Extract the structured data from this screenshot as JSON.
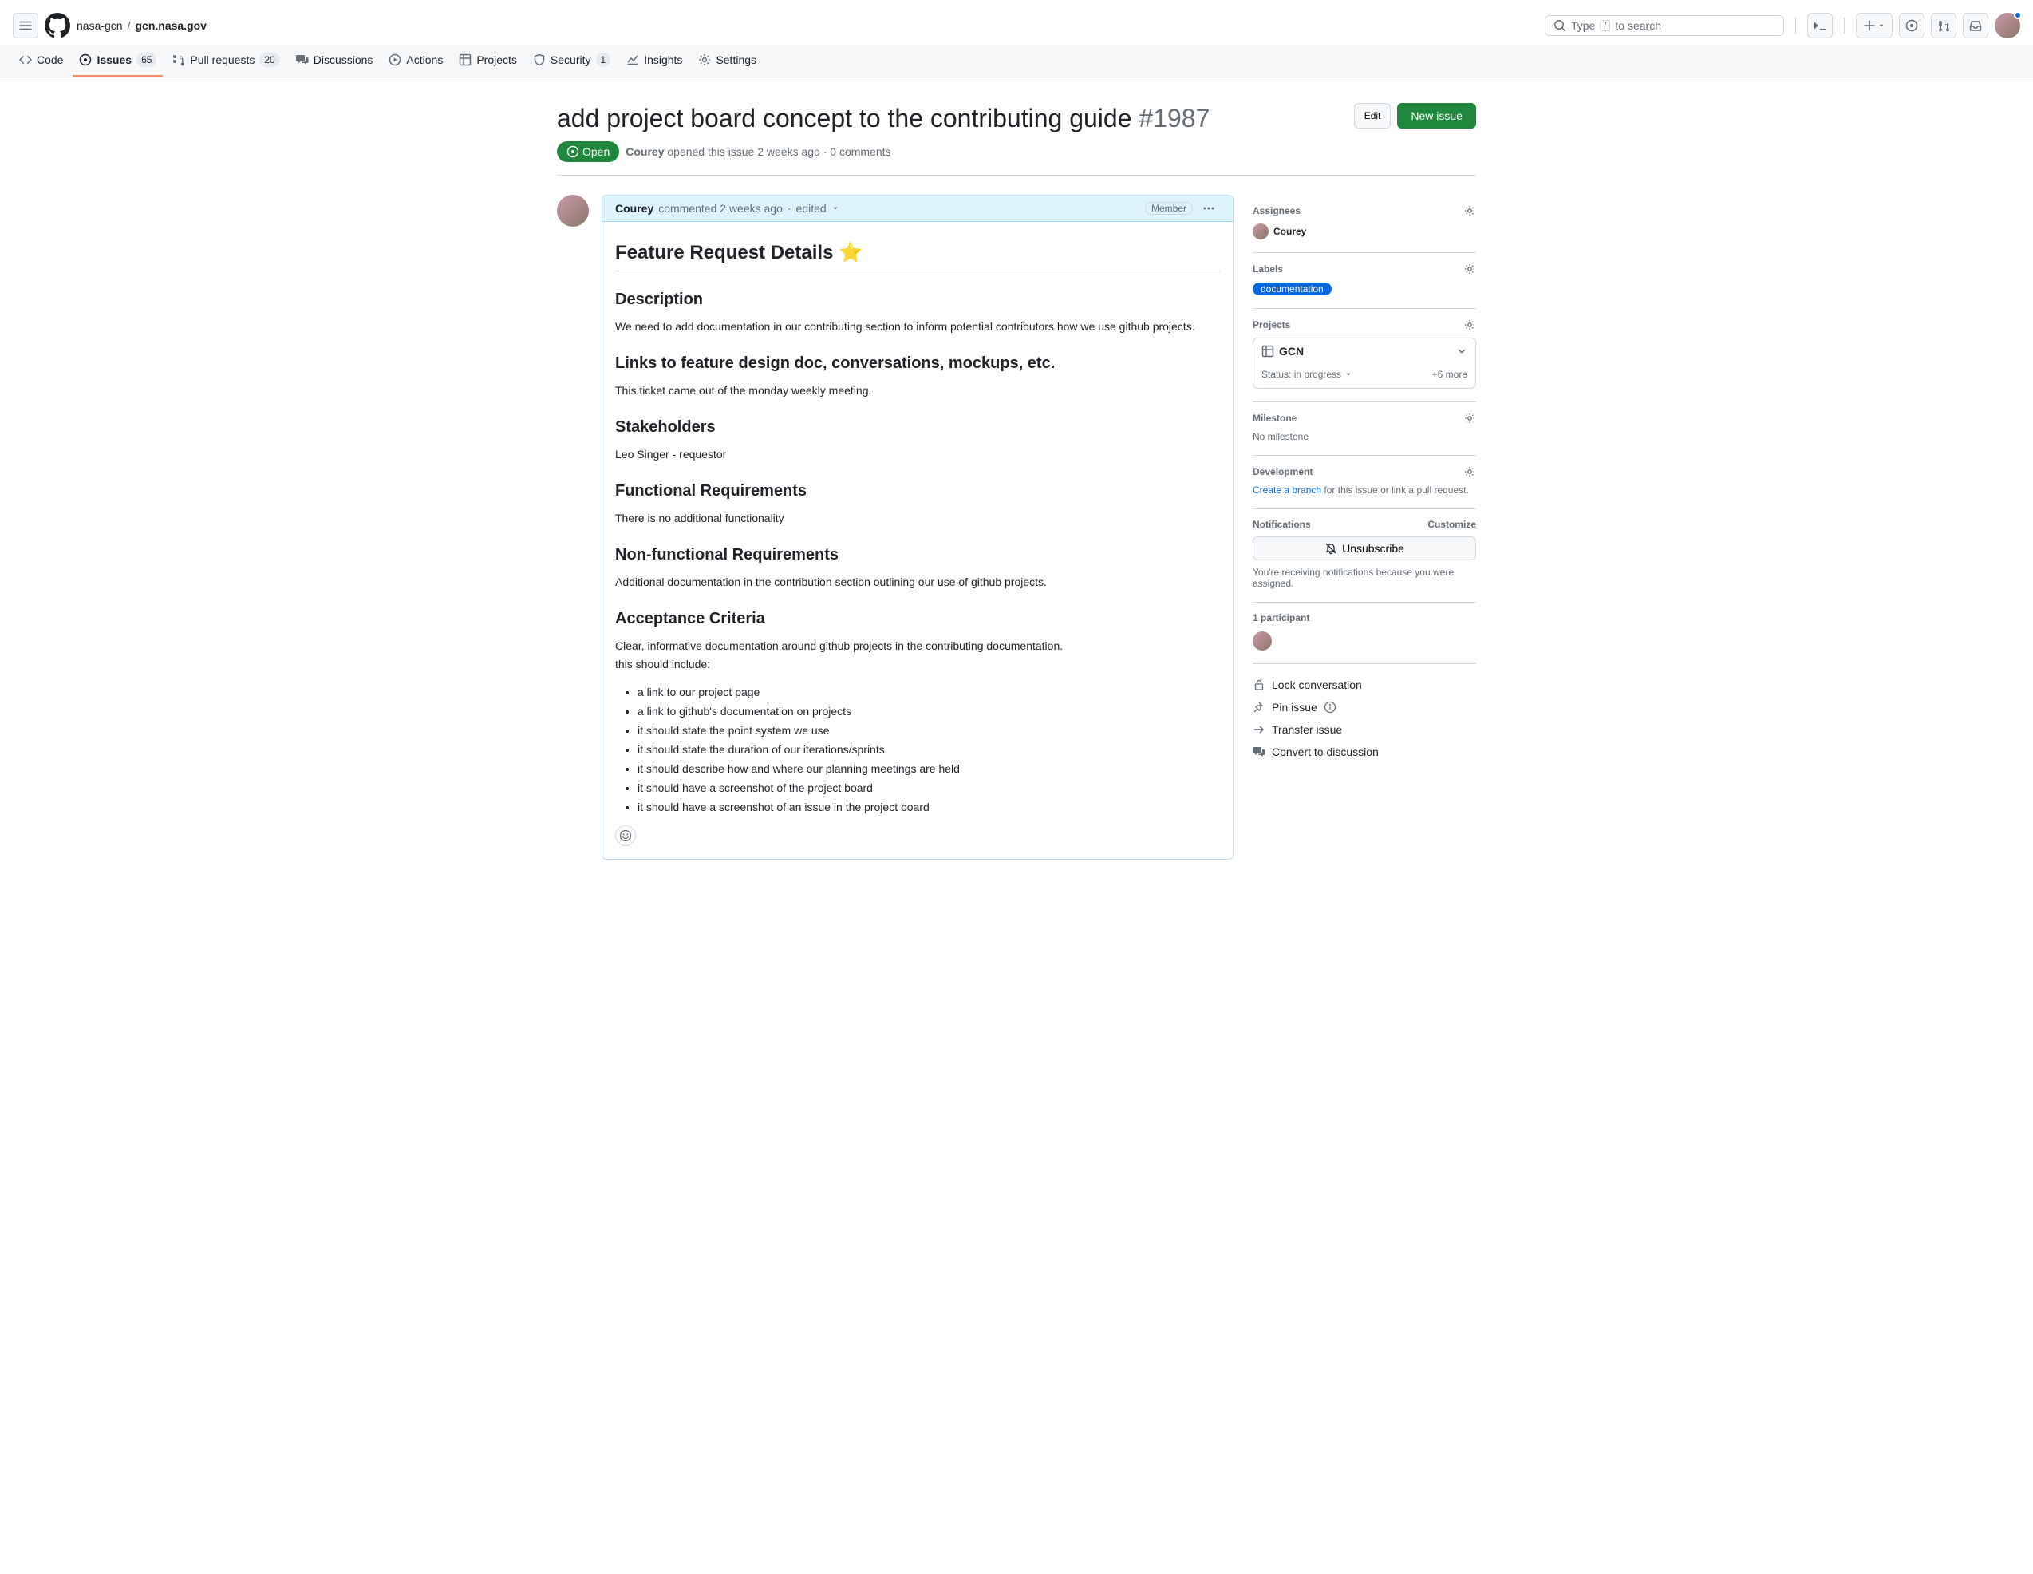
{
  "breadcrumb": {
    "owner": "nasa-gcn",
    "repo": "gcn.nasa.gov"
  },
  "search": {
    "prefix": "Type ",
    "suffix": " to search",
    "kbd": "/"
  },
  "nav": {
    "code": "Code",
    "issues": "Issues",
    "issues_count": "65",
    "pulls": "Pull requests",
    "pulls_count": "20",
    "discussions": "Discussions",
    "actions": "Actions",
    "projects": "Projects",
    "security": "Security",
    "security_count": "1",
    "insights": "Insights",
    "settings": "Settings"
  },
  "issue": {
    "title": "add project board concept to the contributing guide",
    "number": "#1987",
    "edit": "Edit",
    "new_issue": "New issue",
    "state": "Open",
    "author": "Courey",
    "opened_text": " opened this issue 2 weeks ago · 0 comments"
  },
  "comment": {
    "author": "Courey",
    "commented": " commented 2 weeks ago",
    "dot": " · ",
    "edited": "edited ",
    "badge": "Member",
    "h2": "Feature Request Details ⭐",
    "desc_h": "Description",
    "desc_p": "We need to add documentation in our contributing section to inform potential contributors how we use github projects.",
    "links_h": "Links to feature design doc, conversations, mockups, etc.",
    "links_p": "This ticket came out of the monday weekly meeting.",
    "stake_h": "Stakeholders",
    "stake_p": "Leo Singer - requestor",
    "func_h": "Functional Requirements",
    "func_p": "There is no additional functionality",
    "nonfunc_h": "Non-functional Requirements",
    "nonfunc_p": "Additional documentation in the contribution section outlining our use of github projects.",
    "accept_h": "Acceptance Criteria",
    "accept_p1": "Clear, informative documentation around github projects in the contributing documentation.",
    "accept_p2": "this should include:",
    "items": [
      "a link to our project page",
      "a link to github's documentation on projects",
      "it should state the point system we use",
      "it should state the duration of our iterations/sprints",
      "it should describe how and where our planning meetings are held",
      "it should have a screenshot of the project board",
      "it should have a screenshot of an issue in the project board"
    ]
  },
  "sidebar": {
    "assignees_h": "Assignees",
    "assignee": "Courey",
    "labels_h": "Labels",
    "label": "documentation",
    "projects_h": "Projects",
    "project_name": "GCN",
    "project_status": "Status: in progress",
    "project_more": "+6 more",
    "milestone_h": "Milestone",
    "milestone_none": "No milestone",
    "dev_h": "Development",
    "dev_link": "Create a branch",
    "dev_text": " for this issue or link a pull request.",
    "notif_h": "Notifications",
    "customize": "Customize",
    "unsubscribe": "Unsubscribe",
    "notif_desc": "You're receiving notifications because you were assigned.",
    "participants": "1 participant",
    "lock": "Lock conversation",
    "pin": "Pin issue",
    "transfer": "Transfer issue",
    "convert": "Convert to discussion"
  }
}
